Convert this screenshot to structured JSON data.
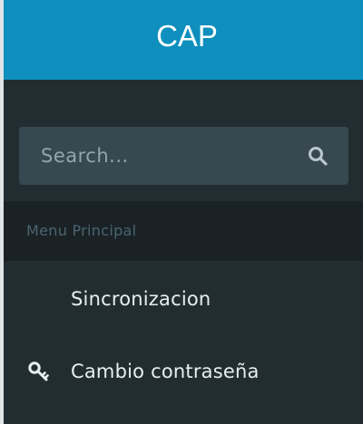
{
  "header": {
    "title": "CAP",
    "color": "#0e8fbd"
  },
  "search": {
    "placeholder": "Search...",
    "icon": "search-icon"
  },
  "menu": {
    "section_title": "Menu Principal",
    "items": [
      {
        "label": "Sincronizacion",
        "icon": ""
      },
      {
        "label": "Cambio contraseña",
        "icon": "key-icon"
      }
    ]
  }
}
